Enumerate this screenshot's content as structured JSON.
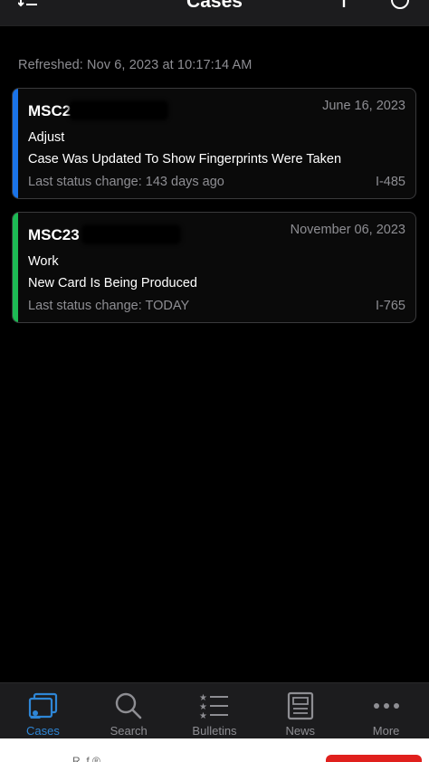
{
  "navbar": {
    "title": "Cases",
    "left_icon": "sort-icon",
    "right_icons": [
      "add-icon",
      "refresh-icon"
    ]
  },
  "refreshed": "Refreshed: Nov 6, 2023 at 10:17:14 AM",
  "cases": [
    {
      "receipt": "MSC2",
      "date": "June 16, 2023",
      "type": "Adjust",
      "status": "Case Was Updated To Show Fingerprints Were Taken",
      "last_change": "Last status change: 143 days ago",
      "form": "I-485",
      "accent_color": "#1a73e8"
    },
    {
      "receipt": "MSC23",
      "date": "November 06, 2023",
      "type": "Work",
      "status": "New Card Is Being Produced",
      "last_change": "Last status change: TODAY",
      "form": "I-765",
      "accent_color": "#1db954"
    }
  ],
  "tabs": [
    {
      "label": "Cases",
      "icon": "cases-icon",
      "active": true
    },
    {
      "label": "Search",
      "icon": "search-icon",
      "active": false
    },
    {
      "label": "Bulletins",
      "icon": "bulletins-icon",
      "active": false
    },
    {
      "label": "News",
      "icon": "news-icon",
      "active": false
    },
    {
      "label": "More",
      "icon": "more-icon",
      "active": false
    }
  ],
  "colors": {
    "background": "#000000",
    "bar": "#1c1c1e",
    "active_tab": "#2e86d6",
    "inactive_tab": "#8e8e93",
    "secondary_text": "#8e8e93"
  },
  "ad": {
    "text": "R..f ®"
  }
}
